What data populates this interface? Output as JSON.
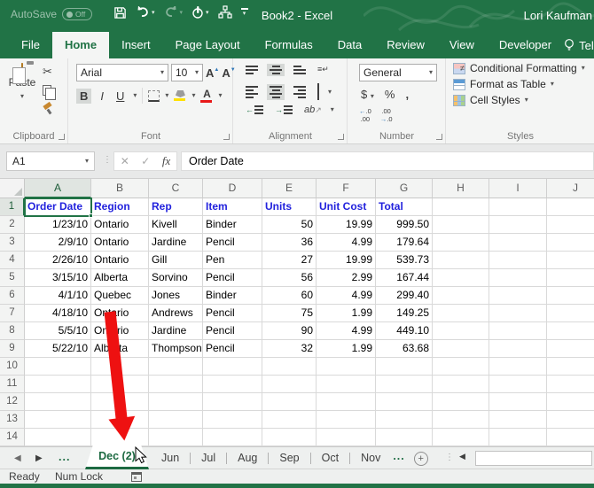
{
  "title_bar": {
    "autosave_label": "AutoSave",
    "autosave_state": "Off",
    "title": "Book2  -  Excel",
    "user": "Lori Kaufman"
  },
  "ribbon_tabs": [
    {
      "label": "File",
      "active": false
    },
    {
      "label": "Home",
      "active": true
    },
    {
      "label": "Insert",
      "active": false
    },
    {
      "label": "Page Layout",
      "active": false
    },
    {
      "label": "Formulas",
      "active": false
    },
    {
      "label": "Data",
      "active": false
    },
    {
      "label": "Review",
      "active": false
    },
    {
      "label": "View",
      "active": false
    },
    {
      "label": "Developer",
      "active": false
    }
  ],
  "tell_me_label": "Tell m",
  "ribbon": {
    "clipboard": {
      "group_label": "Clipboard",
      "paste_label": "Paste"
    },
    "font": {
      "group_label": "Font",
      "family": "Arial",
      "size": "10",
      "bold": "B",
      "italic": "I",
      "underline": "U"
    },
    "alignment": {
      "group_label": "Alignment",
      "orientation": "ab"
    },
    "number": {
      "group_label": "Number",
      "format": "General",
      "currency": "$",
      "percent": "%",
      "comma": ","
    },
    "styles": {
      "group_label": "Styles",
      "items": [
        "Conditional Formatting",
        "Format as Table",
        "Cell Styles"
      ]
    }
  },
  "formula_bar": {
    "name_box": "A1",
    "fx": "fx",
    "value": "Order Date"
  },
  "grid": {
    "col_letters": [
      "A",
      "B",
      "C",
      "D",
      "E",
      "F",
      "G",
      "H",
      "I",
      "J"
    ],
    "row_count": 14,
    "selected": {
      "cell": "A1",
      "col_index": 0,
      "row_number": 1
    },
    "header_row": [
      "Order Date",
      "Region",
      "Rep",
      "Item",
      "Units",
      "Unit Cost",
      "Total"
    ],
    "data_rows": [
      [
        "1/23/10",
        "Ontario",
        "Kivell",
        "Binder",
        "50",
        "19.99",
        "999.50"
      ],
      [
        "2/9/10",
        "Ontario",
        "Jardine",
        "Pencil",
        "36",
        "4.99",
        "179.64"
      ],
      [
        "2/26/10",
        "Ontario",
        "Gill",
        "Pen",
        "27",
        "19.99",
        "539.73"
      ],
      [
        "3/15/10",
        "Alberta",
        "Sorvino",
        "Pencil",
        "56",
        "2.99",
        "167.44"
      ],
      [
        "4/1/10",
        "Quebec",
        "Jones",
        "Binder",
        "60",
        "4.99",
        "299.40"
      ],
      [
        "4/18/10",
        "Ontario",
        "Andrews",
        "Pencil",
        "75",
        "1.99",
        "149.25"
      ],
      [
        "5/5/10",
        "Ontario",
        "Jardine",
        "Pencil",
        "90",
        "4.99",
        "449.10"
      ],
      [
        "5/22/10",
        "Alberta",
        "Thompson",
        "Pencil",
        "32",
        "1.99",
        "63.68"
      ]
    ]
  },
  "sheet_bar": {
    "left_overflow": "...",
    "active_tab": "Dec (2)",
    "tabs": [
      "Jun",
      "Jul",
      "Aug",
      "Sep",
      "Oct",
      "Nov"
    ],
    "right_overflow": "..."
  },
  "status_bar": {
    "mode": "Ready",
    "keyboard": "Num Lock"
  },
  "colors": {
    "accent_green": "#217346",
    "header_text_blue": "#2222dd",
    "arrow_red": "#ee1111",
    "highlight_yellow": "#ffe100",
    "font_color_red": "#e81919"
  }
}
